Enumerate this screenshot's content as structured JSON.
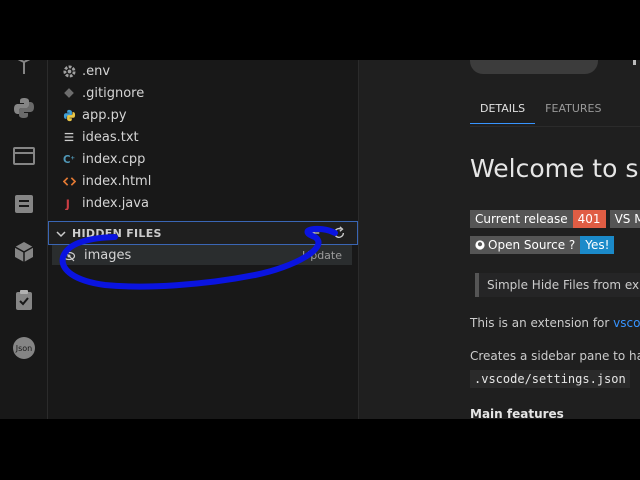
{
  "sidebar": {
    "files": [
      {
        "name": ".env",
        "icon": "gear-icon",
        "color": "#a0a0a0"
      },
      {
        "name": ".gitignore",
        "icon": "git-icon",
        "color": "#6d6d6d"
      },
      {
        "name": "app.py",
        "icon": "python-icon",
        "color": "#3f9fd8"
      },
      {
        "name": "ideas.txt",
        "icon": "lines-icon",
        "color": "#cccccc"
      },
      {
        "name": "index.cpp",
        "icon": "cpp-icon",
        "color": "#519aba"
      },
      {
        "name": "index.html",
        "icon": "html-icon",
        "color": "#e37933"
      },
      {
        "name": "index.java",
        "icon": "java-icon",
        "color": "#cc3e44"
      }
    ],
    "hidden_section": {
      "title": "HIDDEN FILES",
      "item": "images",
      "item_action": "Update"
    }
  },
  "panel": {
    "tabs": [
      {
        "label": "DETAILS",
        "active": true
      },
      {
        "label": "FEATURES",
        "active": false
      }
    ],
    "heading": "Welcome to sin",
    "badges_row1": {
      "label": "Current release",
      "value": "401",
      "label2": "VS Ma"
    },
    "badges_row2": {
      "label": "Open Source ?",
      "value": "Yes!"
    },
    "quote": "Simple Hide Files from exp",
    "intro_prefix": "This is an extension for ",
    "intro_link": "vscodi",
    "creates": "Creates a sidebar pane to han",
    "code": ".vscode/settings.json",
    "main_features": "Main features"
  },
  "colors": {
    "accent": "#3794ff",
    "annotation": "#0a14e0",
    "badge_red": "#e05d44",
    "badge_blue": "#1b8ac9"
  }
}
